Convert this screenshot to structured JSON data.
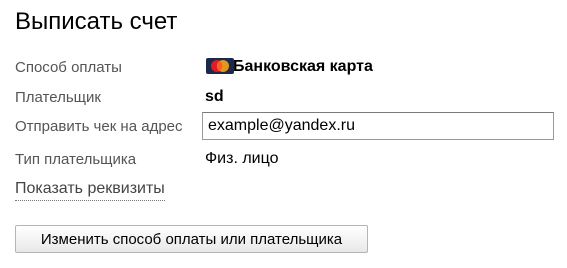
{
  "title": "Выписать счет",
  "payment_method": {
    "label": "Способ оплаты",
    "value": "Банковская карта",
    "icon": "mastercard-icon"
  },
  "payer": {
    "label": "Плательщик",
    "value": "sd"
  },
  "receipt_email": {
    "label": "Отправить чек на адрес",
    "value": "example@yandex.ru"
  },
  "payer_type": {
    "label": "Тип плательщика",
    "value": "Физ. лицо"
  },
  "show_details_link": "Показать реквизиты",
  "change_button": "Изменить способ оплаты или плательщика"
}
